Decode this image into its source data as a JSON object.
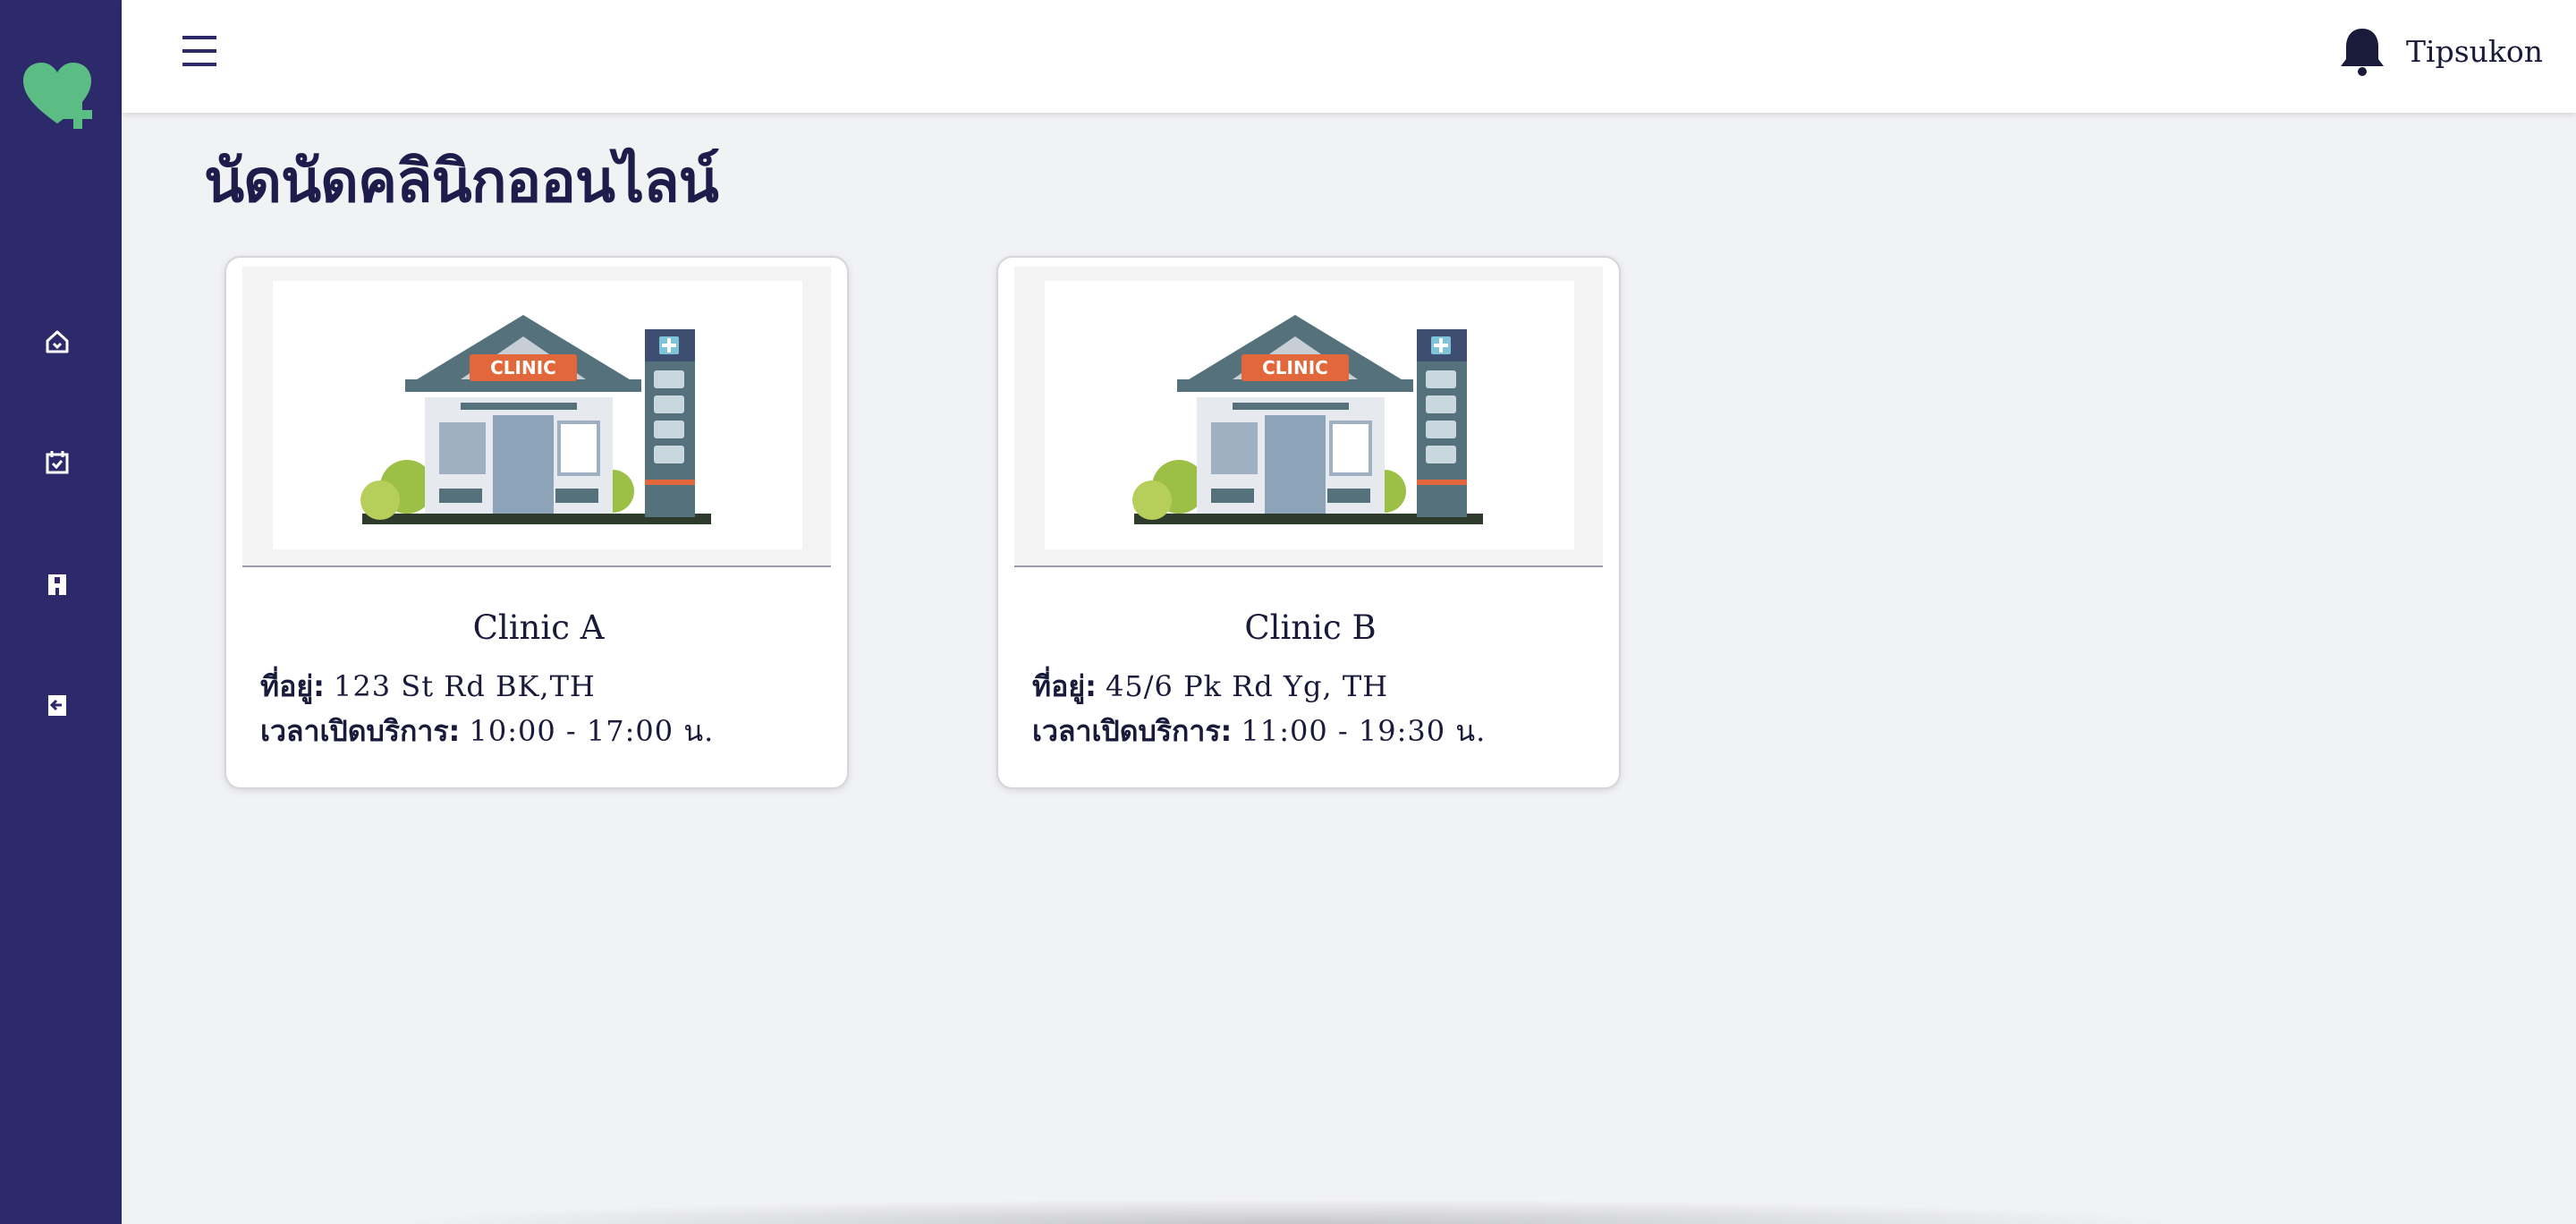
{
  "app": {
    "brand_color": "#2d2a6b",
    "accent_color": "#5cbd84",
    "logo_icon": "heart-plus-logo"
  },
  "sidebar": {
    "items": [
      {
        "name": "home",
        "icon": "home-icon"
      },
      {
        "name": "appointments",
        "icon": "calendar-check-icon"
      },
      {
        "name": "clinics",
        "icon": "building-icon"
      },
      {
        "name": "logout",
        "icon": "logout-icon"
      }
    ]
  },
  "header": {
    "menu_icon": "hamburger-menu-icon",
    "notification_icon": "bell-icon",
    "username": "Tipsukon"
  },
  "main": {
    "title": "นัดนัดคลินิกออนไลน์",
    "clinics": [
      {
        "name": "Clinic A",
        "image_sign": "CLINIC",
        "address_label": "ที่อยู่:",
        "address": "123 St Rd BK,TH",
        "hours_label": "เวลาเปิดบริการ:",
        "hours": "10:00 - 17:00 น."
      },
      {
        "name": "Clinic B",
        "image_sign": "CLINIC",
        "address_label": "ที่อยู่:",
        "address": "45/6 Pk Rd Yg, TH",
        "hours_label": "เวลาเปิดบริการ:",
        "hours": "11:00 - 19:30 น."
      }
    ]
  }
}
